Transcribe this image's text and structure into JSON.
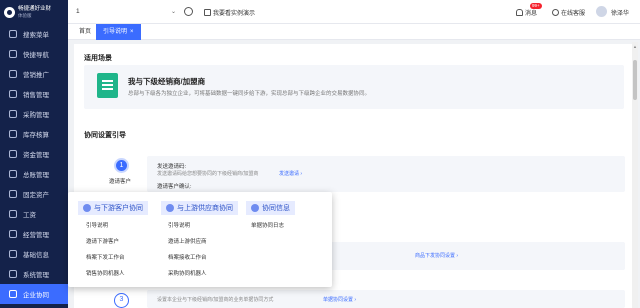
{
  "app": {
    "logo_title": "畅捷通好业财",
    "logo_sub": "体验版"
  },
  "sidebar": {
    "items": [
      {
        "label": "搜索菜单",
        "icon": "search-icon"
      },
      {
        "label": "快捷导航",
        "icon": "grid-icon"
      },
      {
        "label": "营销推广",
        "icon": "megaphone-icon"
      },
      {
        "label": "销售管理",
        "icon": "cart-icon"
      },
      {
        "label": "采购管理",
        "icon": "box-icon"
      },
      {
        "label": "库存核算",
        "icon": "warehouse-icon"
      },
      {
        "label": "资金管理",
        "icon": "wallet-icon"
      },
      {
        "label": "总账管理",
        "icon": "ledger-icon"
      },
      {
        "label": "固定资产",
        "icon": "building-icon"
      },
      {
        "label": "工资",
        "icon": "money-icon"
      },
      {
        "label": "经营管理",
        "icon": "chart-icon"
      },
      {
        "label": "基础信息",
        "icon": "info-icon"
      },
      {
        "label": "系统管理",
        "icon": "gear-icon"
      },
      {
        "label": "企业协同",
        "icon": "link-icon"
      }
    ],
    "active_index": 13
  },
  "topbar": {
    "select_value": "1",
    "demo_link": "我要看实例演示",
    "msg_label": "消息",
    "msg_badge": "99+",
    "cs_label": "在线客服",
    "username": "徐泽华"
  },
  "tabs": [
    {
      "label": "首页"
    },
    {
      "label": "引导说明",
      "close": "×"
    }
  ],
  "main": {
    "scenario_title": "适用场景",
    "card_title": "我与下级经销商/加盟商",
    "card_desc": "总部与下级各为独立企业，可将基础数据一键同步给下游，实现总部与下级跨企业的交易数据协同。",
    "setup_title": "协同设置引导",
    "step1_num": "1",
    "step1_label": "邀请客户",
    "step1_title": "发送邀请码:",
    "step1_desc": "发送邀请码给您想要协同的下级经销商/加盟商",
    "step1_link": "发送邀请 ›",
    "step1_title2": "邀请客户确认:",
    "step2_link": "商品下发协同设置 ›",
    "step3_num": "3",
    "step3_desc": "设置本企业与下级经销商/加盟商的业务单据协同方式",
    "step3_link": "单据协同设置 ›"
  },
  "popup": {
    "tabs": [
      {
        "label": "与下游客户协同",
        "icon": "handshake-icon"
      },
      {
        "label": "与上游供应商协同",
        "icon": "handshake-icon"
      },
      {
        "label": "协同信息",
        "icon": "info-icon"
      }
    ],
    "col1": [
      "引导说明",
      "邀请下游客户",
      "档案下发工作台",
      "销售协同机器人"
    ],
    "col2": [
      "引导说明",
      "邀请上游供应商",
      "档案接收工作台",
      "采购协同机器人"
    ],
    "col3": [
      "单据协同日志"
    ]
  }
}
